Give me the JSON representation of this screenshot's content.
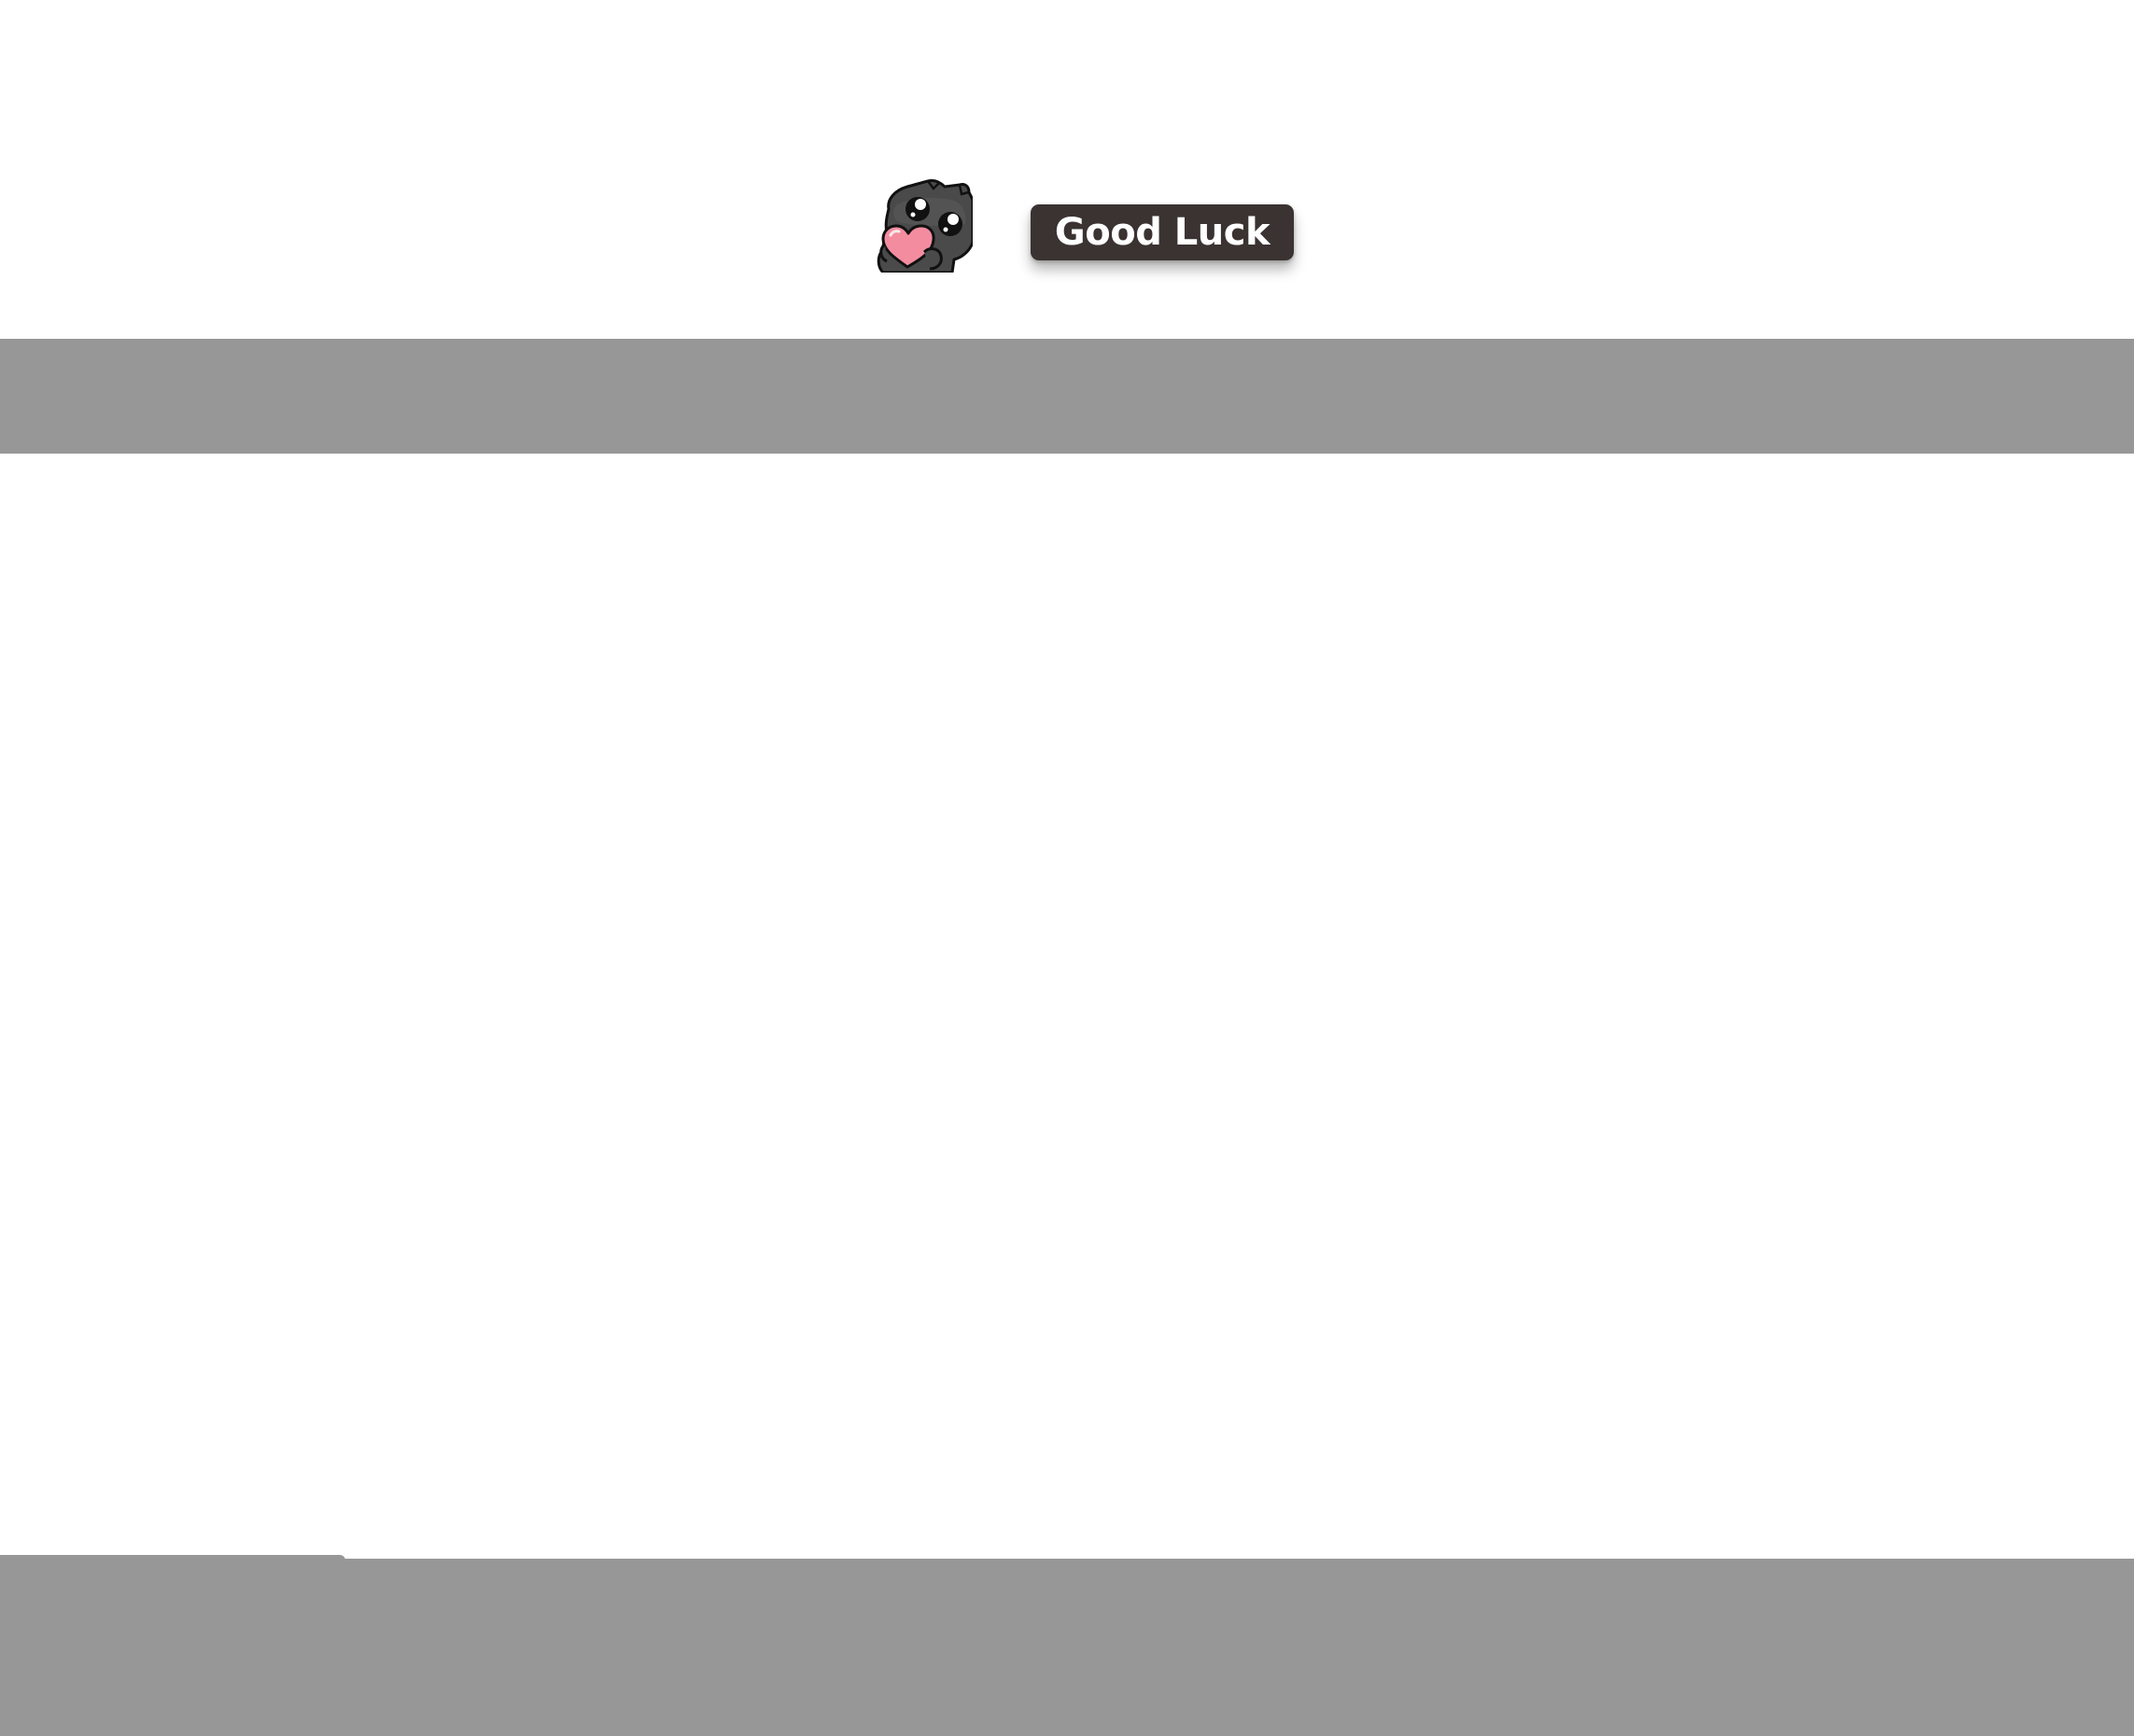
{
  "header": {
    "mascot": {
      "icon": "cat-holding-heart-icon"
    },
    "cta_button": {
      "label": "Good Luck"
    }
  },
  "colors": {
    "background": "#ffffff",
    "band": "#979797",
    "button_background": "#3a3331",
    "button_text": "#ffffff",
    "mascot_body": "#4a4a4a",
    "heart": "#f48ca0"
  }
}
